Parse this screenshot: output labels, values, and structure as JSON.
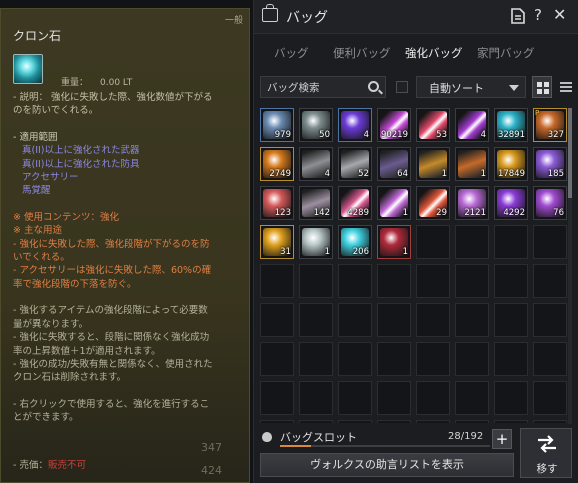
{
  "tooltip": {
    "grade": "一般",
    "item_name": "クロン石",
    "weight_label": "重量：",
    "weight_value": "0.00 LT",
    "desc_1": "- 説明： 強化に失敗した際、強化数値が下がる",
    "desc_2": "のを防いでくれる。",
    "usage_header": "- 適用範囲",
    "usage_1": "真(II)以上に強化された武器",
    "usage_2": "真(II)以上に強化された防具",
    "usage_3": "アクセサリー",
    "usage_4": "馬覚醒",
    "content_line": "※ 使用コンテンツ：強化",
    "main_use": "※ 主な用途",
    "use_1a": "- 強化に失敗した際、強化段階が下がるのを防",
    "use_1b": "いでくれる。",
    "use_2a": "- アクセサリーは強化に失敗した際、60%の確",
    "use_2b": "率で強化段階の下落を防ぐ。",
    "note_1a": "- 強化するアイテムの強化段階によって必要数",
    "note_1b": "量が異なります。",
    "note_2a": "- 強化に失敗すると、段階に関係なく強化成功",
    "note_2b": "率の上昇数値＋1が適用されます。",
    "note_3a": "- 強化の成功/失敗有無と関係なく、使用された",
    "note_3b": "クロン石は削除されます。",
    "rclick_a": "- 右クリックで使用すると、強化を進行するこ",
    "rclick_b": "とができます。",
    "price_label": "- 売価：",
    "price_value": "販売不可",
    "ghost_347": "347",
    "ghost_424": "424"
  },
  "bag": {
    "title": "バッグ",
    "tabs": [
      "バッグ",
      "便利バッグ",
      "強化バッグ",
      "家門バッグ"
    ],
    "active_tab": "強化バッグ",
    "search_placeholder": "バッグ検索",
    "sort_label": "自動ソート",
    "slot_label": "バッグスロット",
    "slot_count": "28/192",
    "slot_fill_fraction": 0.146,
    "vorx_button": "ヴォルクスの助言リストを表示",
    "move_button": "移す",
    "items": [
      {
        "qty": "979",
        "color": "#6a8bb3",
        "frame": "blue",
        "glyph": "stone"
      },
      {
        "qty": "50",
        "color": "#7c8c8e",
        "frame": "filled",
        "glyph": "orb"
      },
      {
        "qty": "4",
        "color": "#6a3bd6",
        "frame": "blue",
        "glyph": "orb"
      },
      {
        "qty": "90219",
        "color": "#c44ad3",
        "frame": "filled",
        "glyph": "shard"
      },
      {
        "qty": "53",
        "color": "#e04a6a",
        "frame": "filled",
        "glyph": "shard"
      },
      {
        "qty": "4",
        "color": "#a23bd0",
        "frame": "filled",
        "glyph": "claw"
      },
      {
        "qty": "32891",
        "color": "#2ab3c8",
        "frame": "filled",
        "glyph": "orb"
      },
      {
        "qty": "327",
        "color": "#c9692a",
        "frame": "gold",
        "glyph": "ring",
        "badge": "P"
      },
      {
        "qty": "2749",
        "color": "#d67a1c",
        "frame": "gold",
        "glyph": "ring"
      },
      {
        "qty": "4",
        "color": "#8d8f93",
        "frame": "filled",
        "glyph": "helm"
      },
      {
        "qty": "52",
        "color": "#a6a8ad",
        "frame": "filled",
        "glyph": "chain"
      },
      {
        "qty": "64",
        "color": "#6a5b8f",
        "frame": "filled",
        "glyph": "chain"
      },
      {
        "qty": "1",
        "color": "#c48a2a",
        "frame": "filled",
        "glyph": "hammer"
      },
      {
        "qty": "1",
        "color": "#c46a2a",
        "frame": "filled",
        "glyph": "hammer"
      },
      {
        "qty": "17849",
        "color": "#d89a1c",
        "frame": "filled",
        "glyph": "flame"
      },
      {
        "qty": "185",
        "color": "#8a5ad6",
        "frame": "filled",
        "glyph": "stone"
      },
      {
        "qty": "123",
        "color": "#d65a5a",
        "frame": "filled",
        "glyph": "stone"
      },
      {
        "qty": "142",
        "color": "#9c8f9f",
        "frame": "filled",
        "glyph": "chain"
      },
      {
        "qty": "4289",
        "color": "#d6588f",
        "frame": "filled",
        "glyph": "shard"
      },
      {
        "qty": "1",
        "color": "#c06ad6",
        "frame": "filled",
        "glyph": "shard"
      },
      {
        "qty": "29",
        "color": "#e0563a",
        "frame": "filled",
        "glyph": "claw"
      },
      {
        "qty": "2121",
        "color": "#b86ad6",
        "frame": "filled",
        "glyph": "orb"
      },
      {
        "qty": "4292",
        "color": "#8a3bd6",
        "frame": "filled",
        "glyph": "orb"
      },
      {
        "qty": "76",
        "color": "#a04ad0",
        "frame": "filled",
        "glyph": "swirl"
      },
      {
        "qty": "31",
        "color": "#e0a01c",
        "frame": "gold",
        "glyph": "ring"
      },
      {
        "qty": "1",
        "color": "#b9c7c7",
        "frame": "filled",
        "glyph": "orb"
      },
      {
        "qty": "206",
        "color": "#3fd1e0",
        "frame": "filled",
        "glyph": "orb"
      },
      {
        "qty": "1",
        "color": "#b02a3a",
        "frame": "red",
        "glyph": "stone"
      }
    ]
  }
}
